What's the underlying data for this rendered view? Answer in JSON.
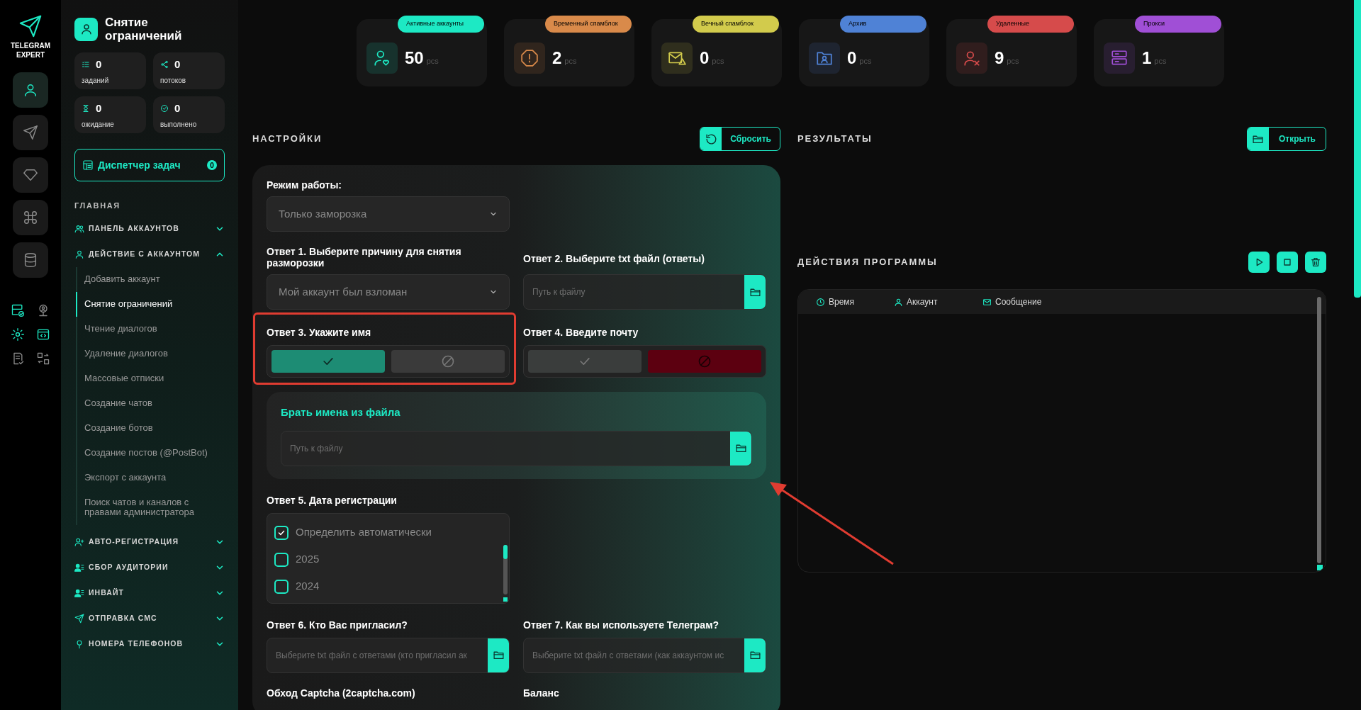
{
  "rail": {
    "logo": "TELEGRAM EXPERT",
    "items": [
      {
        "kind": "user",
        "selected": true
      },
      {
        "kind": "send",
        "selected": false
      },
      {
        "kind": "diamond",
        "selected": false
      },
      {
        "kind": "command",
        "selected": false
      },
      {
        "kind": "database",
        "selected": false
      }
    ]
  },
  "sidebar": {
    "title": "Снятие ограничений",
    "counters": [
      {
        "kind": "tasks",
        "value": "0",
        "label": "заданий"
      },
      {
        "kind": "threads",
        "value": "0",
        "label": "потоков"
      },
      {
        "kind": "waiting",
        "value": "0",
        "label": "ожидание"
      },
      {
        "kind": "done",
        "value": "0",
        "label": "выполнено"
      }
    ],
    "task_manager": {
      "label": "Диспетчер задач",
      "count": "0"
    },
    "heading": "ГЛАВНАЯ",
    "sections": [
      {
        "kind": "users",
        "label": "ПАНЕЛЬ АККАУНТОВ",
        "expanded": false
      },
      {
        "kind": "user",
        "label": "ДЕЙСТВИЕ С АККАУНТОМ",
        "expanded": true,
        "children": [
          {
            "label": "Добавить аккаунт",
            "selected": false
          },
          {
            "label": "Снятие ограничений",
            "selected": true
          },
          {
            "label": "Чтение диалогов",
            "selected": false
          },
          {
            "label": "Удаление диалогов",
            "selected": false
          },
          {
            "label": "Массовые отписки",
            "selected": false
          },
          {
            "label": "Создание чатов",
            "selected": false
          },
          {
            "label": "Создание ботов",
            "selected": false
          },
          {
            "label": "Создание постов (@PostBot)",
            "selected": false
          },
          {
            "label": "Экспорт с аккаунта",
            "selected": false
          },
          {
            "label": "Поиск чатов и каналов с правами администратора",
            "selected": false
          }
        ]
      },
      {
        "kind": "user-plus",
        "label": "АВТО-РЕГИСТРАЦИЯ",
        "expanded": false
      },
      {
        "kind": "user-list",
        "label": "СБОР АУДИТОРИИ",
        "expanded": false
      },
      {
        "kind": "user-list",
        "label": "ИНВАЙТ",
        "expanded": false
      },
      {
        "kind": "send",
        "label": "ОТПРАВКА СМС",
        "expanded": false
      },
      {
        "kind": "pin",
        "label": "НОМЕРА ТЕЛЕФОНОВ",
        "expanded": false
      }
    ]
  },
  "stats": [
    {
      "kind": "active",
      "label": "Активные аккаунты",
      "value": "50",
      "unit": "pcs",
      "color": "#1de9c4"
    },
    {
      "kind": "temp",
      "label": "Временный спамблок",
      "value": "2",
      "unit": "pcs",
      "color": "#d98a4a"
    },
    {
      "kind": "eternal",
      "label": "Вечный спамблок",
      "value": "0",
      "unit": "pcs",
      "color": "#d2cb4c"
    },
    {
      "kind": "archive",
      "label": "Архив",
      "value": "0",
      "unit": "pcs",
      "color": "#4f82d6"
    },
    {
      "kind": "deleted",
      "label": "Удаленные",
      "value": "9",
      "unit": "pcs",
      "color": "#d64b4b"
    },
    {
      "kind": "proxy",
      "label": "Прокси",
      "value": "1",
      "unit": "pcs",
      "color": "#a04fd6"
    }
  ],
  "settings": {
    "title": "НАСТРОЙКИ",
    "reset": "Сбросить",
    "mode": {
      "label": "Режим работы:",
      "value": "Только заморозка"
    },
    "answer1": {
      "label": "Ответ 1. Выберите причину для снятия разморозки",
      "value": "Мой аккаунт был взломан"
    },
    "answer2": {
      "label": "Ответ 2. Выберите txt файл (ответы)",
      "placeholder": "Путь к файлу"
    },
    "answer3": {
      "label": "Ответ 3. Укажите имя",
      "options": [
        {
          "kind": "yes",
          "selected": true
        },
        {
          "kind": "no",
          "selected": false
        }
      ]
    },
    "answer4": {
      "label": "Ответ 4. Введите почту",
      "options": [
        {
          "kind": "yes",
          "selected": false
        },
        {
          "kind": "no",
          "selected": true
        }
      ]
    },
    "names_file": {
      "title": "Брать имена из файла",
      "placeholder": "Путь к файлу"
    },
    "answer5": {
      "label": "Ответ 5. Дата регистрации",
      "options": [
        {
          "label": "Определить автоматически",
          "checked": true
        },
        {
          "label": "2025",
          "checked": false
        },
        {
          "label": "2024",
          "checked": false
        }
      ]
    },
    "answer6": {
      "label": "Ответ 6. Кто Вас пригласил?",
      "placeholder": "Выберите txt файл с ответами (кто пригласил ак"
    },
    "answer7": {
      "label": "Ответ 7. Как вы используете Телеграм?",
      "placeholder": "Выберите txt файл с ответами (как аккаунтом ис"
    },
    "captcha": {
      "label": "Обход Captcha (2captcha.com)"
    },
    "balance": {
      "label": "Баланс"
    }
  },
  "results": {
    "title": "РЕЗУЛЬТАТЫ",
    "open": "Открыть"
  },
  "log": {
    "title": "ДЕЙСТВИЯ ПРОГРАММЫ",
    "columns": [
      {
        "kind": "time",
        "label": "Время"
      },
      {
        "kind": "account",
        "label": "Аккаунт"
      },
      {
        "kind": "message",
        "label": "Сообщение"
      }
    ]
  }
}
